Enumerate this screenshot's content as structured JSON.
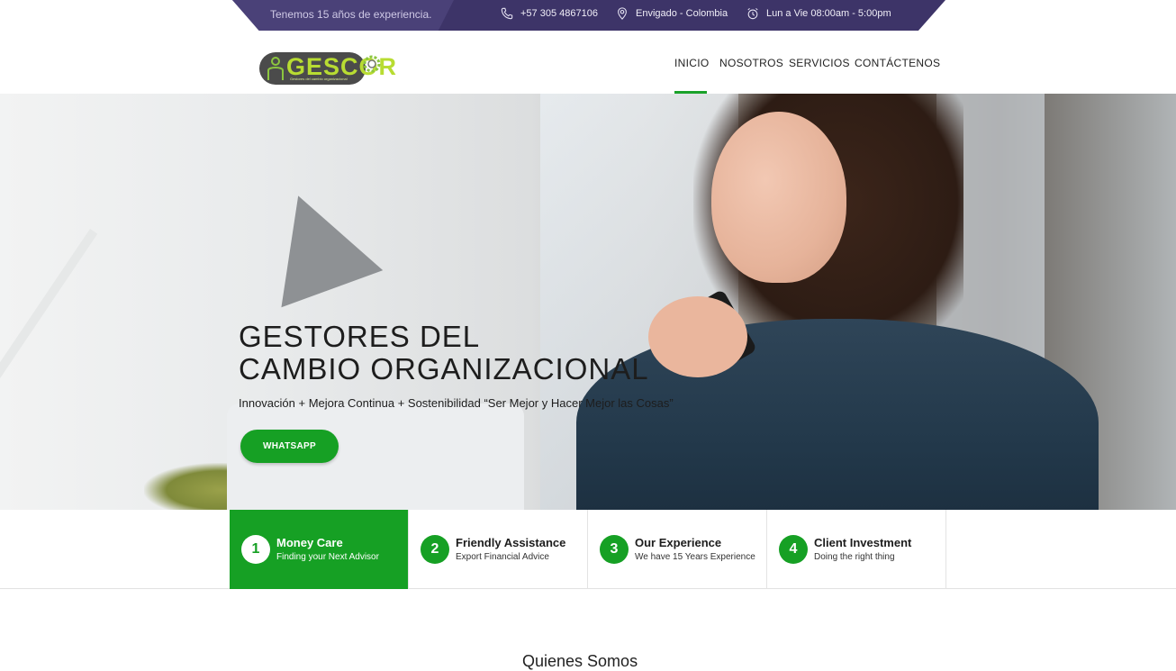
{
  "topbar": {
    "experience": "Tenemos 15 años de experiencia.",
    "phone": "+57 305 4867106",
    "location": "Envigado - Colombia",
    "hours": "Lun a Vie 08:00am - 5:00pm",
    "phone_icon": "phone-icon",
    "location_icon": "map-pin-icon",
    "hours_icon": "alarm-clock-icon"
  },
  "logo": {
    "text": "GESCOR",
    "tagline": "Gestores del cambio organizacional"
  },
  "nav": {
    "items": [
      "INICIO",
      "NOSOTROS",
      "SERVICIOS",
      "CONTÁCTENOS"
    ],
    "active": "INICIO"
  },
  "hero": {
    "title_line1": "GESTORES DEL",
    "title_line2": "CAMBIO ORGANIZACIONAL",
    "subtitle": "Innovación + Mejora Continua + Sostenibilidad “Ser Mejor y Hacer Mejor las Cosas”",
    "button": "WHATSAPP"
  },
  "features": [
    {
      "num": "1",
      "title": "Money Care",
      "subtitle": "Finding your Next Advisor"
    },
    {
      "num": "2",
      "title": "Friendly Assistance",
      "subtitle": "Export Financial Advice"
    },
    {
      "num": "3",
      "title": "Our Experience",
      "subtitle": "We have 15 Years Experience"
    },
    {
      "num": "4",
      "title": "Client Investment",
      "subtitle": "Doing the right thing"
    }
  ],
  "section_peek": "Quienes Somos",
  "colors": {
    "topbar": "#3d3468",
    "accent_green": "#16a024",
    "logo_green": "#b8dc32"
  }
}
